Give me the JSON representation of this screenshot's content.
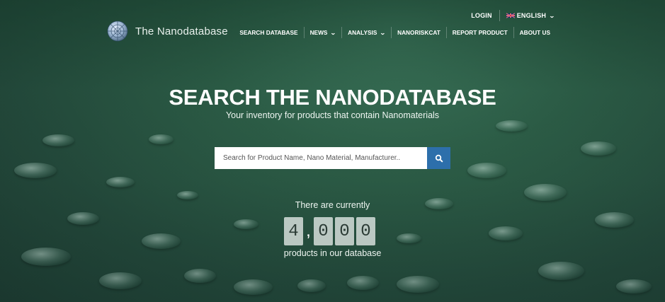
{
  "app": {
    "name": "The Nanodatabase",
    "logo_icon": "nanoparticle-sphere-icon"
  },
  "topbar": {
    "login_label": "LOGIN",
    "language_label": "ENGLISH",
    "language_flag": "uk-flag-icon",
    "language_chevron": "chevron-down-icon"
  },
  "nav": {
    "items": [
      {
        "label": "SEARCH DATABASE",
        "has_dropdown": false
      },
      {
        "label": "NEWS",
        "has_dropdown": true
      },
      {
        "label": "ANALYSIS",
        "has_dropdown": true
      },
      {
        "label": "NANORISKCAT",
        "has_dropdown": false
      },
      {
        "label": "REPORT PRODUCT",
        "has_dropdown": false
      },
      {
        "label": "ABOUT US",
        "has_dropdown": false
      }
    ]
  },
  "hero": {
    "title": "SEARCH THE NANODATABASE",
    "subtitle": "Your inventory for products that contain Nanomaterials"
  },
  "search": {
    "value": "",
    "placeholder": "Search for Product Name, Nano Material, Manufacturer..",
    "button_icon": "search-icon",
    "button_color": "#2d6fab"
  },
  "counter": {
    "intro": "There are currently",
    "digits": [
      "4",
      ",",
      "0",
      "0",
      "0"
    ],
    "suffix": "products in our database"
  },
  "colors": {
    "background": "#2d5e47",
    "accent": "#2d6fab"
  }
}
